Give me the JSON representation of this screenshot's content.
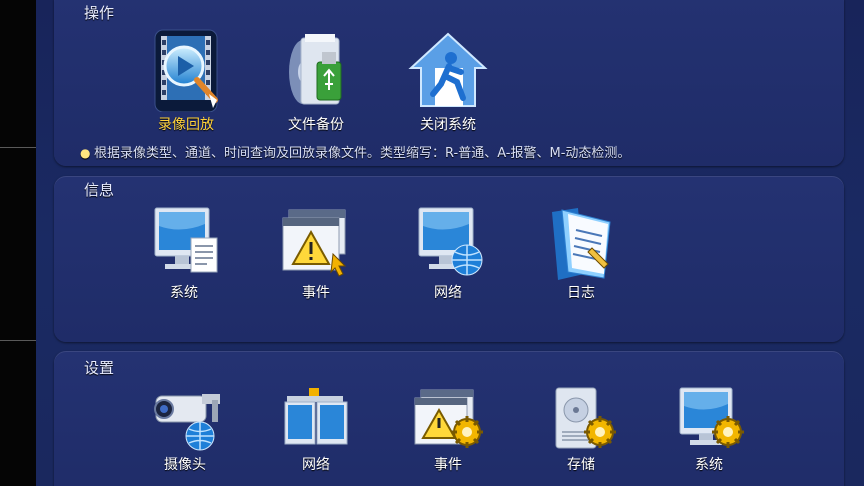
{
  "sections": {
    "operation": {
      "title": "操作",
      "items": [
        {
          "label": "录像回放",
          "icon": "video-playback-icon"
        },
        {
          "label": "文件备份",
          "icon": "file-backup-icon"
        },
        {
          "label": "关闭系统",
          "icon": "shutdown-icon"
        }
      ],
      "hint": "根据录像类型、通道、时间查询及回放录像文件。类型缩写：R-普通、A-报警、M-动态检测。"
    },
    "info": {
      "title": "信息",
      "items": [
        {
          "label": "系统",
          "icon": "system-info-icon"
        },
        {
          "label": "事件",
          "icon": "event-info-icon"
        },
        {
          "label": "网络",
          "icon": "network-info-icon"
        },
        {
          "label": "日志",
          "icon": "log-icon"
        }
      ]
    },
    "settings": {
      "title": "设置",
      "items": [
        {
          "label": "摄像头",
          "icon": "camera-settings-icon"
        },
        {
          "label": "网络",
          "icon": "network-settings-icon"
        },
        {
          "label": "事件",
          "icon": "event-settings-icon"
        },
        {
          "label": "存储",
          "icon": "storage-settings-icon"
        },
        {
          "label": "系统",
          "icon": "system-settings-icon"
        }
      ]
    }
  },
  "colors": {
    "background": "#1a2a63",
    "panel": "#243272",
    "active_label": "#ffd23c",
    "label": "#ffffff"
  }
}
